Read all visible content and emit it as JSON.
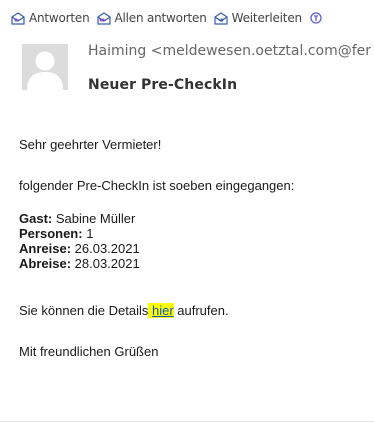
{
  "toolbar": {
    "reply_label": "Antworten",
    "reply_all_label": "Allen antworten",
    "forward_label": "Weiterleiten",
    "more_icon": "teams-share-icon"
  },
  "message": {
    "sender": "Haiming <meldewesen.oetztal.com@fer",
    "subject": "Neuer Pre-CheckIn"
  },
  "body": {
    "greeting": "Sehr geehrter Vermieter!",
    "intro": "folgender Pre-CheckIn ist soeben eingegangen:",
    "guest_label": "Gast:",
    "guest_value": " Sabine Müller",
    "persons_label": "Personen:",
    "persons_value": " 1",
    "arrival_label": "Anreise:",
    "arrival_value": " 26.03.2021",
    "departure_label": "Abreise:",
    "departure_value": " 28.03.2021",
    "link_prefix": "Sie können die Details",
    "link_space": " ",
    "link_text": "hier",
    "link_suffix": " aufrufen.",
    "closing": "Mit freundlichen Grüßen"
  },
  "colors": {
    "link": "#1155cc",
    "highlight": "#ffff00",
    "avatar_bg": "#dcdcdc"
  }
}
